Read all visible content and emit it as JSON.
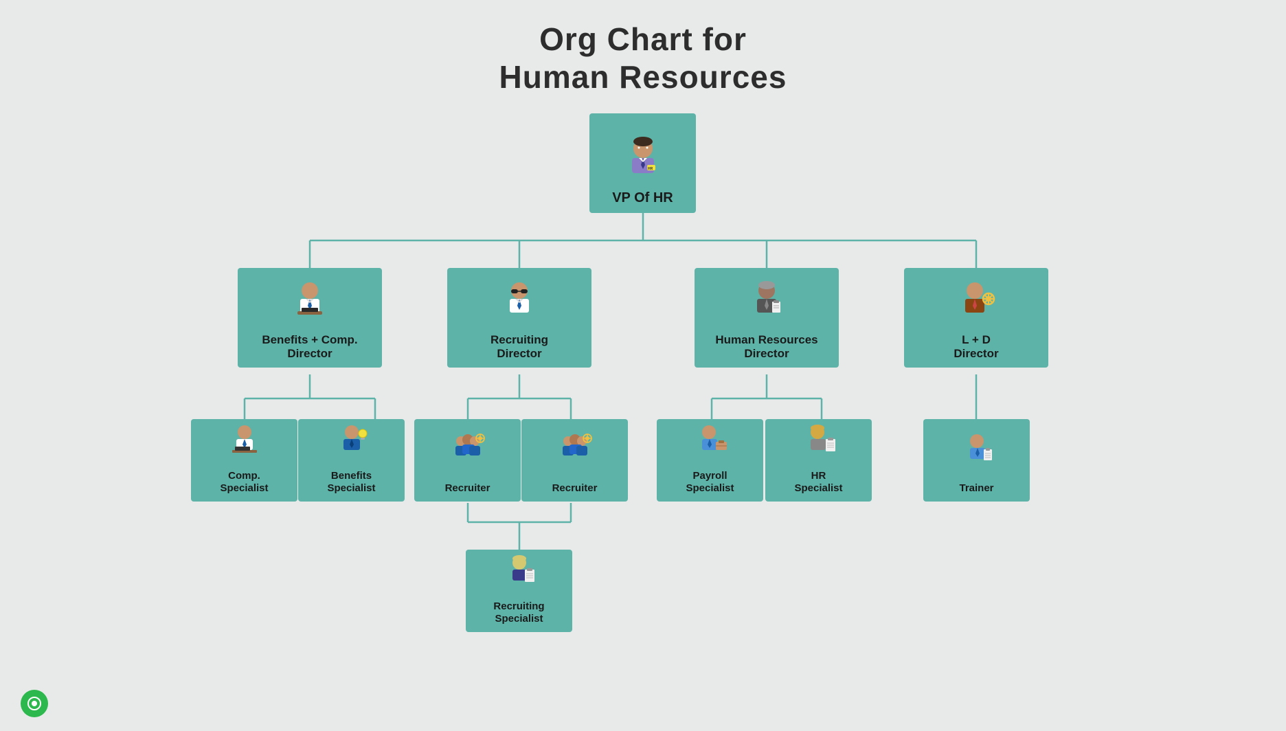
{
  "title": {
    "line1": "Org Chart for",
    "line2": "Human Resources"
  },
  "nodes": {
    "vp": {
      "label": "VP Of HR"
    },
    "dir1": {
      "label": "Benefits + Comp.\nDirector"
    },
    "dir2": {
      "label": "Recruiting\nDirector"
    },
    "dir3": {
      "label": "Human Resources\nDirector"
    },
    "dir4": {
      "label": "L + D\nDirector"
    },
    "spec1": {
      "label": "Comp.\nSpecialist"
    },
    "spec2": {
      "label": "Benefits\nSpecialist"
    },
    "spec3": {
      "label": "Recruiter"
    },
    "spec4": {
      "label": "Recruiter"
    },
    "spec5": {
      "label": "Payroll\nSpecialist"
    },
    "spec6": {
      "label": "HR\nSpecialist"
    },
    "spec7": {
      "label": "Trainer"
    },
    "spec8": {
      "label": "Recruiting\nSpecialist"
    }
  },
  "colors": {
    "node_bg": "#5db3a8",
    "line_color": "#5db3a8",
    "bg": "#e8eaea",
    "title": "#2d2d2d"
  },
  "bottom_icon": "⊙"
}
